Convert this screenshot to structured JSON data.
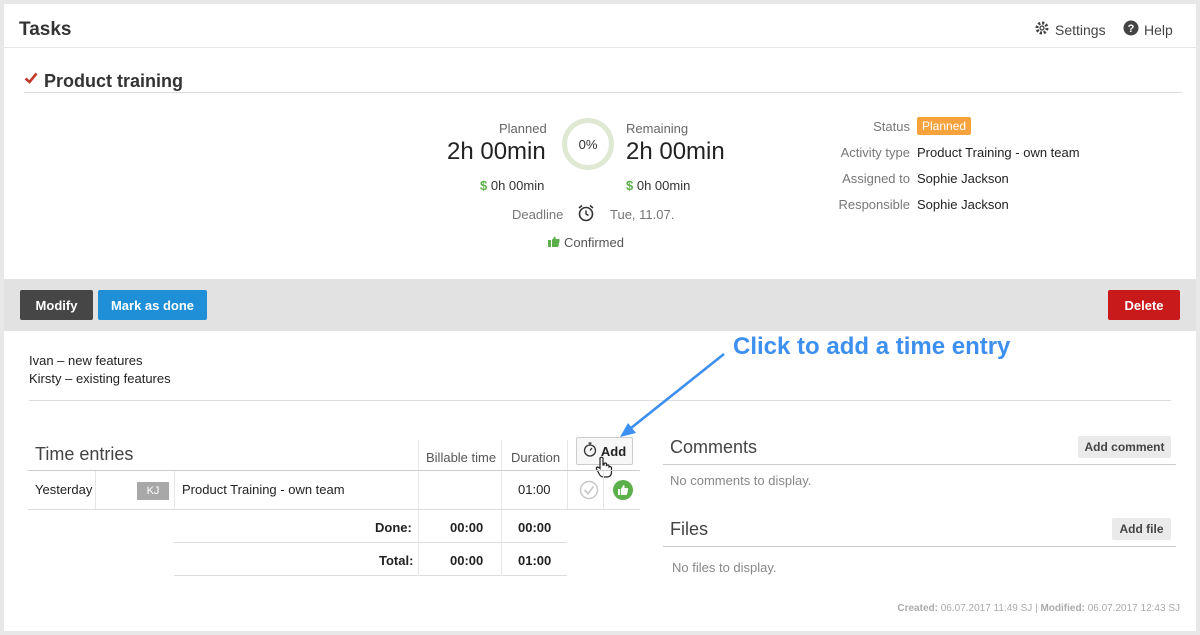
{
  "header": {
    "title": "Tasks",
    "settings_label": "Settings",
    "help_label": "Help"
  },
  "task": {
    "title": "Product training",
    "planned_label": "Planned",
    "planned_value": "2h 00min",
    "planned_money": "0h 00min",
    "progress": "0%",
    "remaining_label": "Remaining",
    "remaining_value": "2h 00min",
    "remaining_money": "0h 00min",
    "currency_symbol": "$",
    "deadline_label": "Deadline",
    "deadline_value": "Tue, 11.07.",
    "confirmed_label": "Confirmed"
  },
  "details": {
    "status_label": "Status",
    "status_value": "Planned",
    "activity_label": "Activity type",
    "activity_value": "Product Training - own team",
    "assigned_label": "Assigned to",
    "assigned_value": "Sophie Jackson",
    "responsible_label": "Responsible",
    "responsible_value": "Sophie Jackson"
  },
  "actions": {
    "modify": "Modify",
    "mark_done": "Mark as done",
    "delete": "Delete"
  },
  "description": {
    "line1": "Ivan – new features",
    "line2": "Kirsty – existing features"
  },
  "annotation": "Click to add a time entry",
  "time_entries": {
    "title": "Time entries",
    "col_billable": "Billable time",
    "col_duration": "Duration",
    "add_label": "Add",
    "rows": [
      {
        "date": "Yesterday",
        "user": "KJ",
        "activity": "Product Training - own team",
        "billable": "",
        "duration": "01:00"
      }
    ],
    "done_label": "Done:",
    "done_billable": "00:00",
    "done_duration": "00:00",
    "total_label": "Total:",
    "total_billable": "00:00",
    "total_duration": "01:00"
  },
  "comments": {
    "title": "Comments",
    "add_label": "Add comment",
    "empty": "No comments to display."
  },
  "files": {
    "title": "Files",
    "add_label": "Add file",
    "empty": "No files to display."
  },
  "footer": {
    "created_label": "Created:",
    "created_value": "06.07.2017 11:49 SJ",
    "modified_label": "Modified:",
    "modified_value": "06.07.2017 12:43 SJ",
    "separator": "|"
  },
  "colors": {
    "accent_blue": "#1f8fd8",
    "delete_red": "#c81a1a",
    "status_orange": "#f6a33d",
    "money_green": "#5bb04a",
    "hint_blue": "#3d8ff0"
  }
}
